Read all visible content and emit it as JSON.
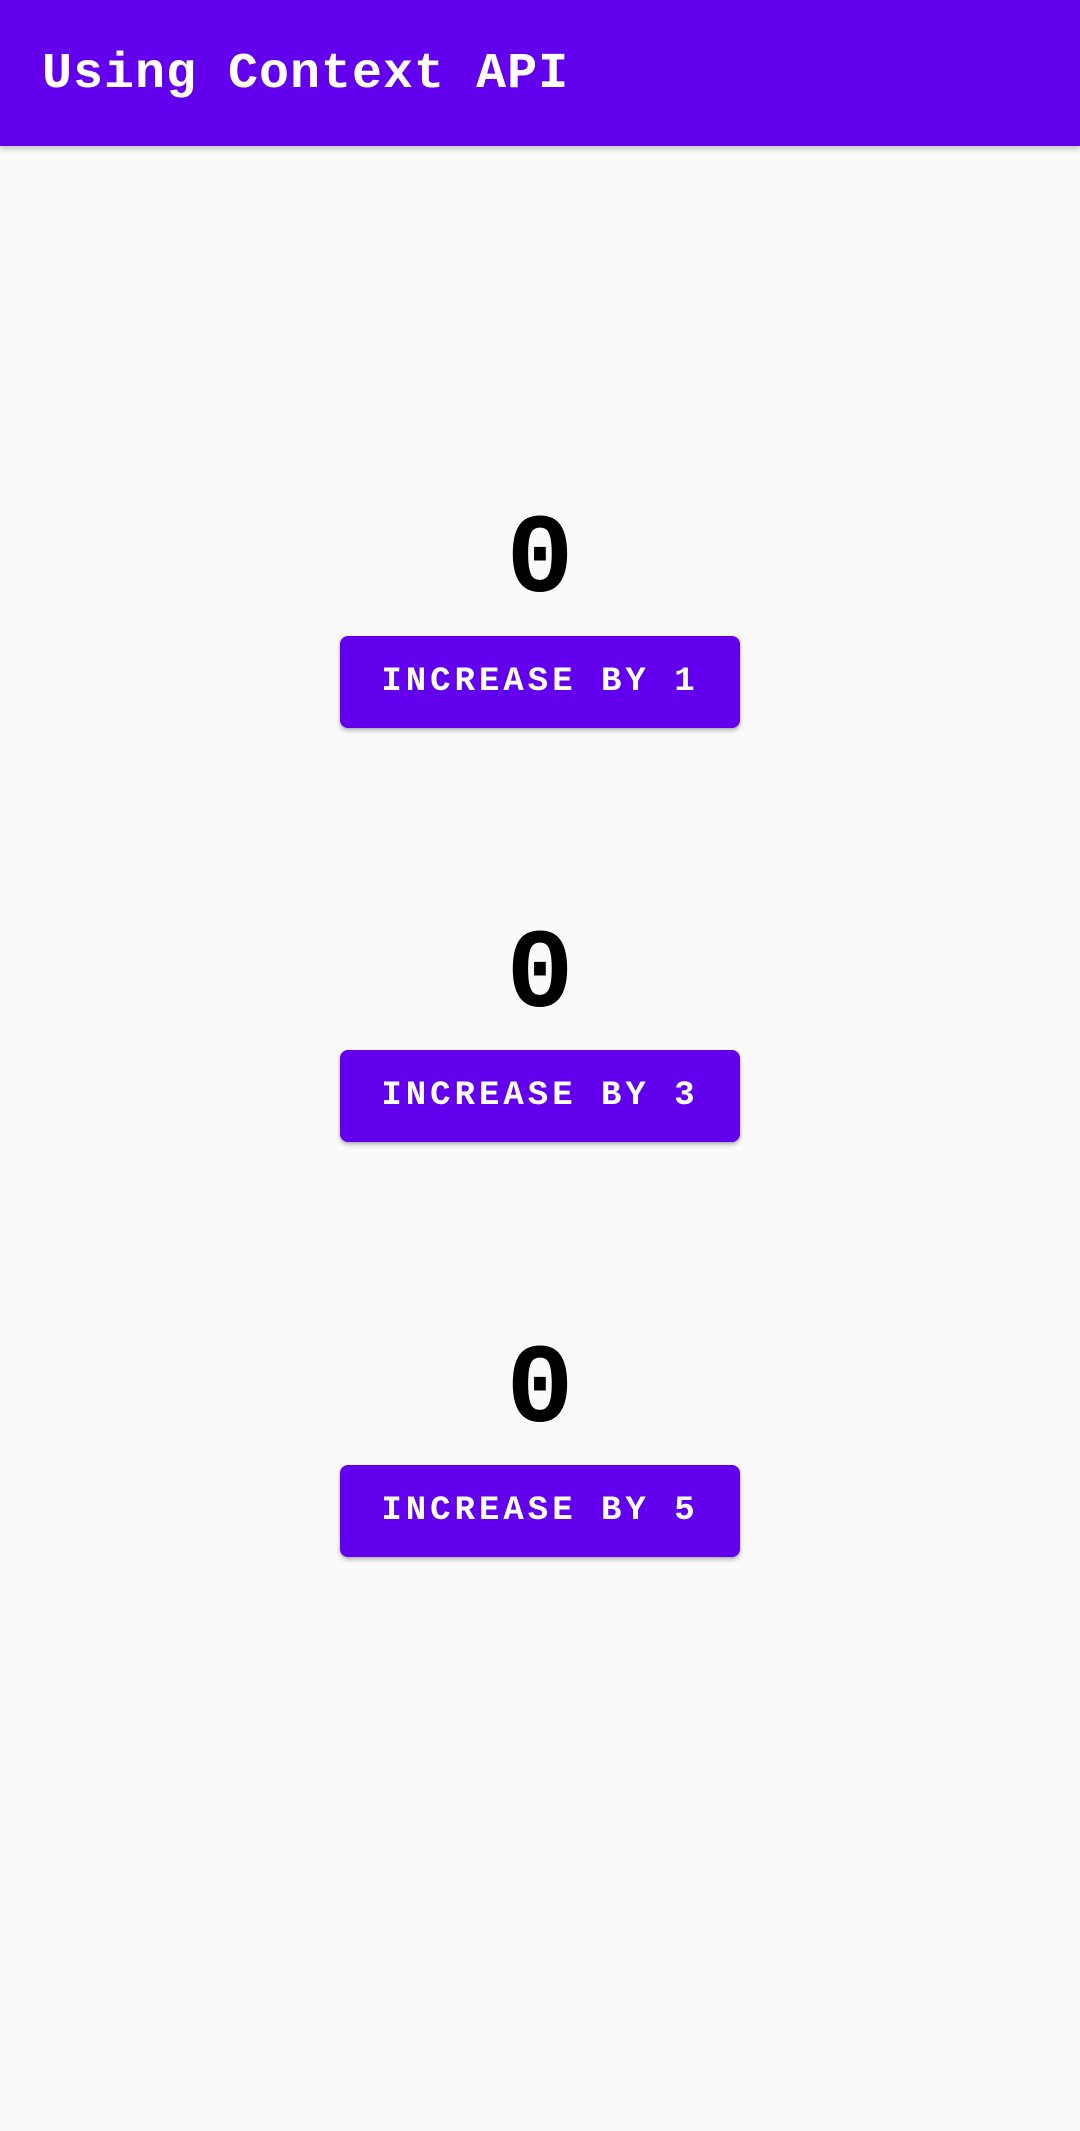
{
  "app_bar": {
    "title": "Using Context API",
    "color": "#6200ee"
  },
  "counters": [
    {
      "count": "0",
      "button_label": "INCREASE BY 1"
    },
    {
      "count": "0",
      "button_label": "INCREASE BY 3"
    },
    {
      "count": "0",
      "button_label": "INCREASE BY 5"
    }
  ],
  "colors": {
    "accent": "#6200ee",
    "background": "#fafafa",
    "count_text": "#000000",
    "button_text": "#ffffff"
  }
}
